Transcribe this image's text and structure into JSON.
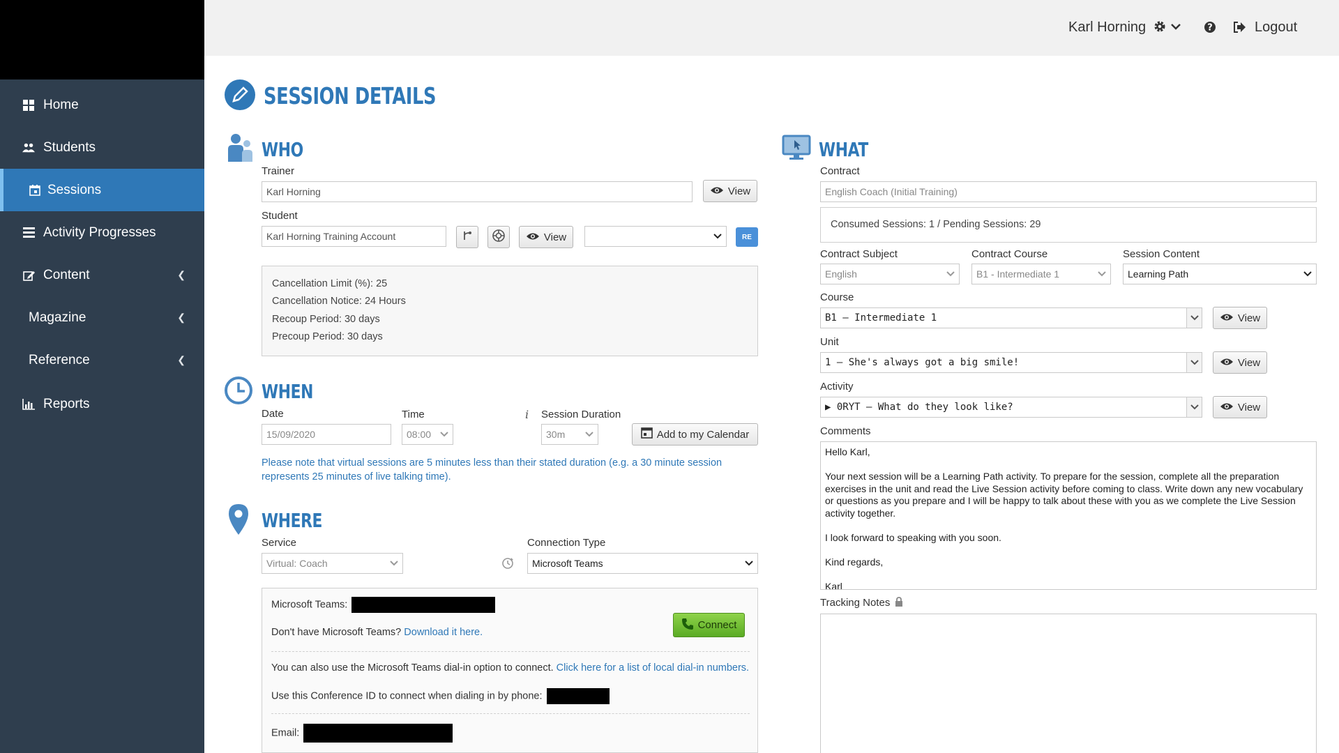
{
  "header": {
    "user_name": "Karl Horning",
    "logout_label": "Logout"
  },
  "sidebar": {
    "items": [
      {
        "label": "Home",
        "icon": "home-icon"
      },
      {
        "label": "Students",
        "icon": "users-icon"
      },
      {
        "label": "Sessions",
        "icon": "calendar-icon",
        "active": true
      },
      {
        "label": "Activity Progresses",
        "icon": "list-icon"
      },
      {
        "label": "Content",
        "icon": "edit-icon"
      },
      {
        "label": "Magazine"
      },
      {
        "label": "Reference"
      },
      {
        "label": "Reports",
        "icon": "bar-chart-icon"
      }
    ]
  },
  "page": {
    "title": "SESSION DETAILS"
  },
  "who": {
    "title": "WHO",
    "trainer_label": "Trainer",
    "trainer_value": "Karl Horning",
    "view_label": "View",
    "student_label": "Student",
    "student_value": "Karl Horning Training Account",
    "re_badge": "RE",
    "info": [
      "Cancellation Limit (%): 25",
      "Cancellation Notice: 24 Hours",
      "Recoup Period: 30 days",
      "Precoup Period: 30 days"
    ]
  },
  "when": {
    "title": "WHEN",
    "date_label": "Date",
    "date_value": "15/09/2020",
    "time_label": "Time",
    "time_value": "08:00",
    "duration_label": "Session Duration",
    "duration_value": "30m",
    "calendar_button": "Add to my Calendar",
    "note": "Please note that virtual sessions are 5 minutes less than their stated duration (e.g. a 30 minute session represents 25 minutes of live talking time)."
  },
  "where": {
    "title": "WHERE",
    "service_label": "Service",
    "service_value": "Virtual: Coach",
    "connection_label": "Connection Type",
    "connection_value": "Microsoft Teams",
    "teams_label": "Microsoft Teams:",
    "no_teams_text": "Don't have Microsoft Teams?",
    "download_link": "Download it here.",
    "connect_button": "Connect",
    "dialin_text": "You can also use the Microsoft Teams dial-in option to connect.",
    "dialin_link": "Click here for a list of local dial-in numbers.",
    "conference_text": "Use this Conference ID to connect when dialing in by phone:",
    "email_label": "Email:"
  },
  "what": {
    "title": "WHAT",
    "contract_label": "Contract",
    "contract_value": "English Coach (Initial Training)",
    "sessions_info": "Consumed Sessions: 1 / Pending Sessions: 29",
    "contract_subject_label": "Contract Subject",
    "contract_subject_value": "English",
    "contract_course_label": "Contract Course",
    "contract_course_value": "B1 - Intermediate 1",
    "session_content_label": "Session Content",
    "session_content_value": "Learning Path",
    "course_label": "Course",
    "course_value": "B1 – Intermediate 1",
    "unit_label": "Unit",
    "unit_value": "1 – She's always got a big smile!",
    "activity_label": "Activity",
    "activity_value": "▶ 0RYT – What do they look like?",
    "view_label": "View",
    "comments_label": "Comments",
    "comments_value": "Hello Karl,\n\nYour next session will be a Learning Path activity. To prepare for the session, complete all the preparation exercises in the unit and read the Live Session activity before coming to class. Write down any new vocabulary or questions as you prepare and I will be happy to talk about these with you as we complete the Live Session activity together.\n\nI look forward to speaking with you soon.\n\nKind regards,\n\nKarl",
    "tracking_label": "Tracking Notes"
  }
}
